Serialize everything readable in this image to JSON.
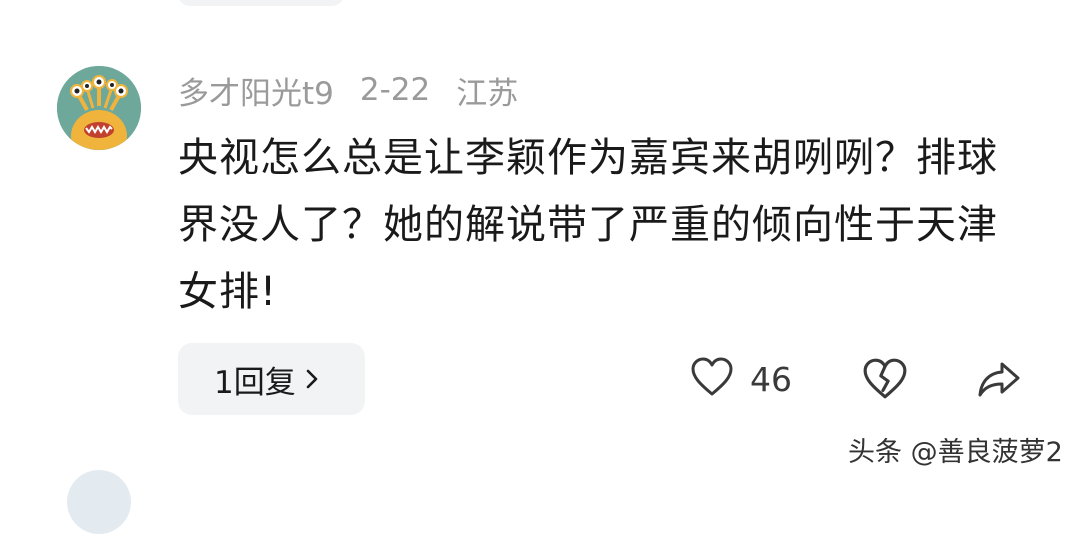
{
  "comment": {
    "username": "多才阳光t9",
    "date": "2-22",
    "location": "江苏",
    "text": "央视怎么总是让李颖作为嘉宾来胡咧咧？排球界没人了？她的解说带了严重的倾向性于天津女排!",
    "avatar_icon": "cartoon-monster-avatar",
    "reply_button_label": "1回复",
    "like_count": "46",
    "icons": {
      "reply_chevron": "chevron-right-icon",
      "like": "heart-outline-icon",
      "dislike": "broken-heart-icon",
      "share": "share-arrow-icon"
    }
  },
  "watermark": "头条 @善良菠萝2",
  "colors": {
    "background": "#ffffff",
    "chip_background": "#f2f3f5",
    "meta_text": "#9a9a9a",
    "body_text": "#1a1a1a",
    "avatar_background": "#6ea89a",
    "avatar_creature": "#f0b43c"
  }
}
